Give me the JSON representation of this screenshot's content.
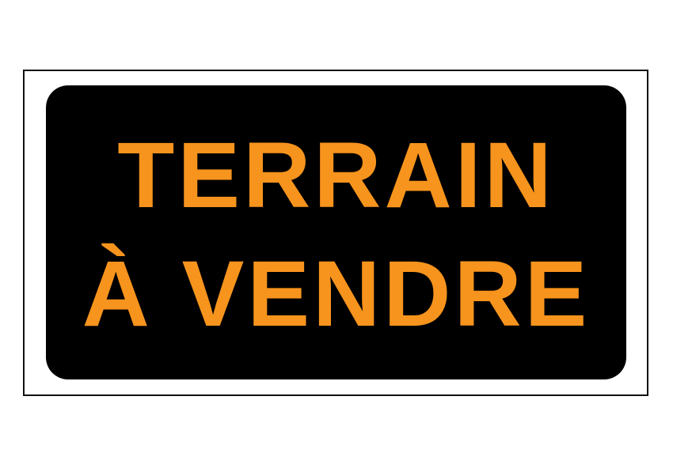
{
  "sign": {
    "line1": "TERRAIN",
    "line2": "À VENDRE"
  },
  "colors": {
    "page_background": "#ffffff",
    "frame_border": "#111111",
    "panel_background": "#000000",
    "text": "#f7941d"
  }
}
